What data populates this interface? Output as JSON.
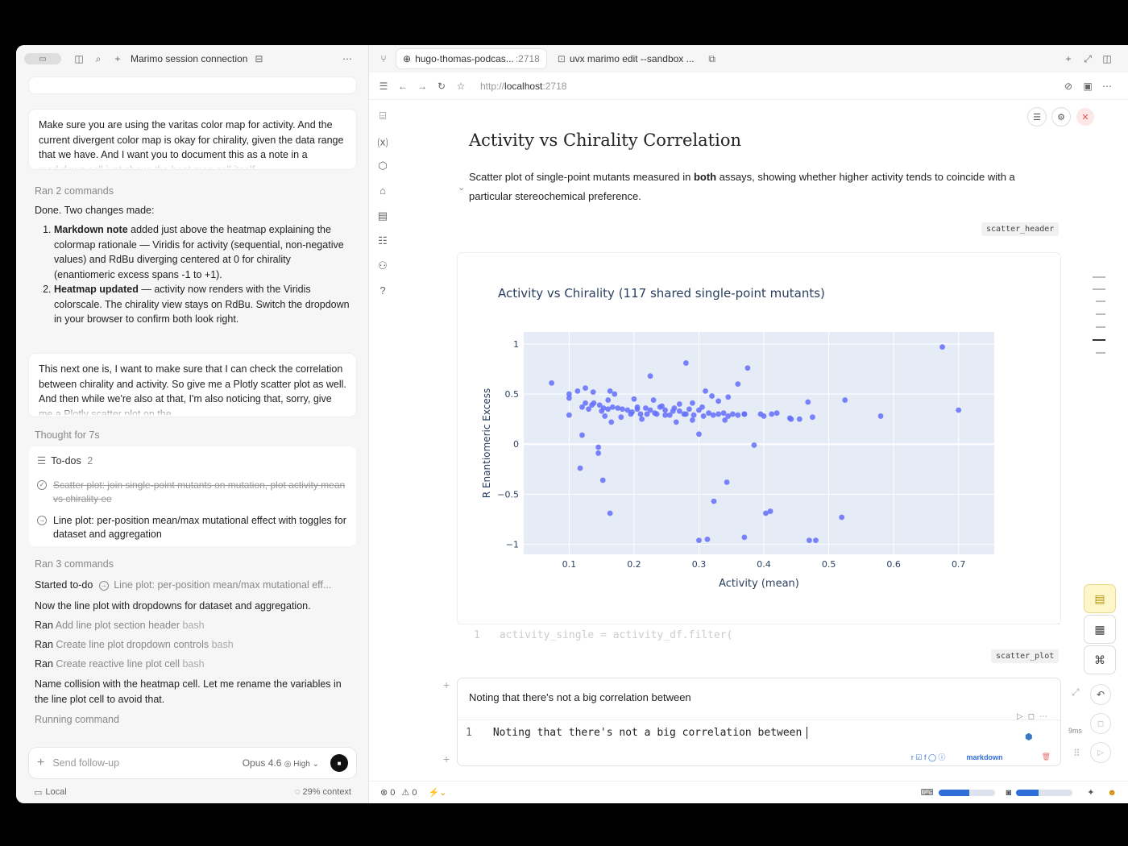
{
  "left": {
    "title": "Marimo session connection",
    "msg1_top": "Make sure you are using the varitas color map for activity. And the current divergent color map is okay for chirality, given the data range that we have. And I want you to document this as a note in a markdown cell just above the heat map cell itself.",
    "ran1": "Ran 2 commands",
    "done": "Done. Two changes made:",
    "item1_bold": "Markdown note",
    "item1_rest": " added just above the heatmap explaining the colormap rationale — Viridis for activity (sequential, non-negative values) and RdBu diverging centered at 0 for chirality (enantiomeric excess spans -1 to +1).",
    "item2_bold": "Heatmap updated",
    "item2_rest": " — activity now renders with the Viridis colorscale. The chirality view stays on RdBu. Switch the dropdown in your browser to confirm both look right.",
    "msg2": "This next one is, I want to make sure that I can check the correlation between chirality and activity. So give me a Plotly scatter plot as well. And then while we're also at that, I'm also noticing that, sorry, give me a Plotly scatter plot on the",
    "thought": "Thought for 7s",
    "todos_label": "To-dos",
    "todos_count": "2",
    "todo1": "Scatter plot: join single-point mutants on mutation, plot activity mean vs chirality ee",
    "todo2": "Line plot: per-position mean/max mutational effect with toggles for dataset and aggregation",
    "ran2": "Ran 3 commands",
    "started": "Started to-do",
    "started_item": "Line plot: per-position mean/max mutational eff...",
    "now_line": "Now the line plot with dropdowns for dataset and aggregation.",
    "r1a": "Ran",
    "r1b": "Add line plot section header",
    "r1c": "bash",
    "r2a": "Ran",
    "r2b": "Create line plot dropdown controls",
    "r2c": "bash",
    "r3a": "Ran",
    "r3b": "Create reactive line plot cell",
    "r3c": "bash",
    "collision": "Name collision with the heatmap cell. Let me rename the variables in the line plot cell to avoid that.",
    "running": "Running command",
    "follow_placeholder": "Send follow-up",
    "model": "Opus 4.6",
    "effort": "High",
    "local": "Local",
    "context": "29% context"
  },
  "tabs": {
    "tab1": "hugo-thomas-podcas...",
    "tab1_port": ":2718",
    "tab2": "uvx marimo edit --sandbox ..."
  },
  "address": {
    "scheme": "http://",
    "host": "localhost",
    "port": ":2718"
  },
  "notebook": {
    "heading": "Activity vs Chirality Correlation",
    "desc_a": "Scatter plot of single-point mutants measured in ",
    "desc_bold": "both",
    "desc_b": " assays, showing whether higher activity tends to coincide with a particular stereochemical preference.",
    "cell1_name": "scatter_header",
    "cell2_name": "scatter_plot",
    "code_ln": "1",
    "code_text": "activity_single = activity_df.filter(",
    "md_render": "Noting that there's not a big correlation between",
    "md_ln": "1",
    "md_text": "Noting that there's not a big correlation between",
    "md_lang": "markdown",
    "timing": "9ms"
  },
  "status": {
    "errors": "0",
    "warnings": "0",
    "bar1": 0.55,
    "bar2": 0.4
  },
  "chart_data": {
    "type": "scatter",
    "title": "Activity vs Chirality (117 shared single-point mutants)",
    "xlabel": "Activity (mean)",
    "ylabel": "R Enantiomeric Excess",
    "xlim": [
      0.03,
      0.755
    ],
    "ylim": [
      -1.1,
      1.12
    ],
    "xticks": [
      0.1,
      0.2,
      0.3,
      0.4,
      0.5,
      0.6,
      0.7
    ],
    "xtick_labels": [
      "0.1",
      "0.2",
      "0.3",
      "0.4",
      "0.5",
      "0.6",
      "0.7"
    ],
    "yticks": [
      1,
      0.5,
      0,
      -0.5,
      -1
    ],
    "ytick_labels": [
      "1",
      "0.5",
      "0",
      "−0.5",
      "−1"
    ],
    "color": "#636efa",
    "background": "#e5ecf6",
    "points": [
      [
        0.675,
        0.97
      ],
      [
        0.28,
        0.81
      ],
      [
        0.225,
        0.68
      ],
      [
        0.375,
        0.76
      ],
      [
        0.36,
        0.6
      ],
      [
        0.073,
        0.61
      ],
      [
        0.1,
        0.5
      ],
      [
        0.113,
        0.53
      ],
      [
        0.125,
        0.56
      ],
      [
        0.137,
        0.52
      ],
      [
        0.163,
        0.53
      ],
      [
        0.17,
        0.5
      ],
      [
        0.1,
        0.46
      ],
      [
        0.12,
        0.37
      ],
      [
        0.125,
        0.41
      ],
      [
        0.13,
        0.35
      ],
      [
        0.138,
        0.41
      ],
      [
        0.147,
        0.39
      ],
      [
        0.153,
        0.36
      ],
      [
        0.16,
        0.35
      ],
      [
        0.167,
        0.37
      ],
      [
        0.175,
        0.36
      ],
      [
        0.182,
        0.35
      ],
      [
        0.19,
        0.34
      ],
      [
        0.197,
        0.32
      ],
      [
        0.205,
        0.35
      ],
      [
        0.21,
        0.3
      ],
      [
        0.218,
        0.36
      ],
      [
        0.225,
        0.34
      ],
      [
        0.232,
        0.31
      ],
      [
        0.24,
        0.37
      ],
      [
        0.248,
        0.34
      ],
      [
        0.255,
        0.29
      ],
      [
        0.262,
        0.36
      ],
      [
        0.27,
        0.33
      ],
      [
        0.277,
        0.3
      ],
      [
        0.285,
        0.35
      ],
      [
        0.292,
        0.29
      ],
      [
        0.3,
        0.34
      ],
      [
        0.307,
        0.28
      ],
      [
        0.315,
        0.31
      ],
      [
        0.322,
        0.29
      ],
      [
        0.33,
        0.3
      ],
      [
        0.338,
        0.31
      ],
      [
        0.345,
        0.28
      ],
      [
        0.352,
        0.3
      ],
      [
        0.36,
        0.29
      ],
      [
        0.37,
        0.3
      ],
      [
        0.1,
        0.29
      ],
      [
        0.155,
        0.28
      ],
      [
        0.2,
        0.45
      ],
      [
        0.23,
        0.44
      ],
      [
        0.27,
        0.4
      ],
      [
        0.29,
        0.41
      ],
      [
        0.32,
        0.48
      ],
      [
        0.33,
        0.43
      ],
      [
        0.31,
        0.53
      ],
      [
        0.345,
        0.47
      ],
      [
        0.205,
        0.37
      ],
      [
        0.248,
        0.29
      ],
      [
        0.165,
        0.22
      ],
      [
        0.18,
        0.27
      ],
      [
        0.212,
        0.25
      ],
      [
        0.265,
        0.22
      ],
      [
        0.29,
        0.24
      ],
      [
        0.34,
        0.24
      ],
      [
        0.305,
        0.37
      ],
      [
        0.22,
        0.3
      ],
      [
        0.28,
        0.3
      ],
      [
        0.395,
        0.3
      ],
      [
        0.4,
        0.28
      ],
      [
        0.412,
        0.3
      ],
      [
        0.42,
        0.31
      ],
      [
        0.44,
        0.26
      ],
      [
        0.442,
        0.25
      ],
      [
        0.468,
        0.42
      ],
      [
        0.525,
        0.44
      ],
      [
        0.58,
        0.28
      ],
      [
        0.7,
        0.34
      ],
      [
        0.3,
        0.1
      ],
      [
        0.37,
        0.3
      ],
      [
        0.15,
        0.33
      ],
      [
        0.16,
        0.44
      ],
      [
        0.135,
        0.39
      ],
      [
        0.12,
        0.09
      ],
      [
        0.145,
        -0.03
      ],
      [
        0.145,
        -0.09
      ],
      [
        0.117,
        -0.24
      ],
      [
        0.152,
        -0.36
      ],
      [
        0.163,
        -0.69
      ],
      [
        0.343,
        -0.38
      ],
      [
        0.323,
        -0.57
      ],
      [
        0.3,
        -0.96
      ],
      [
        0.313,
        -0.95
      ],
      [
        0.37,
        -0.93
      ],
      [
        0.403,
        -0.69
      ],
      [
        0.41,
        -0.67
      ],
      [
        0.47,
        -0.96
      ],
      [
        0.48,
        -0.96
      ],
      [
        0.52,
        -0.73
      ],
      [
        0.385,
        -0.01
      ],
      [
        0.455,
        0.25
      ],
      [
        0.475,
        0.27
      ],
      [
        0.235,
        0.3
      ],
      [
        0.26,
        0.33
      ],
      [
        0.195,
        0.3
      ],
      [
        0.243,
        0.38
      ]
    ]
  }
}
